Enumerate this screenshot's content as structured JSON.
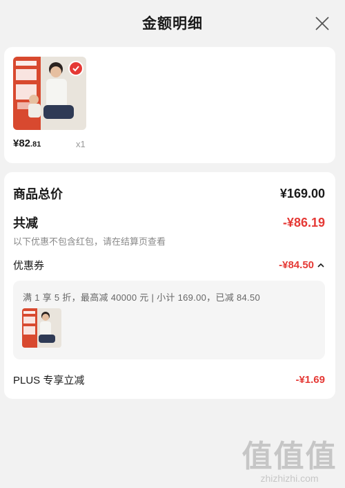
{
  "header": {
    "title": "金额明细"
  },
  "product": {
    "price_int": "¥82",
    "price_dec": ".81",
    "quantity": "x1"
  },
  "summary": {
    "total_label": "商品总价",
    "total_value": "¥169.00",
    "discount_label": "共减",
    "discount_value": "-¥86.19",
    "note": "以下优惠不包含红包，请在结算页查看",
    "coupon_label": "优惠券",
    "coupon_value": "-¥84.50",
    "coupon_detail": "满 1 享 5 折，最高减 40000 元 | 小计 169.00，已减 84.50",
    "plus_label": "PLUS 专享立减",
    "plus_value": "-¥1.69"
  },
  "watermark": {
    "glyphs": "值值值",
    "domain": "zhizhizhi.com"
  },
  "colors": {
    "accent": "#e53935",
    "background": "#f2f2f2"
  }
}
